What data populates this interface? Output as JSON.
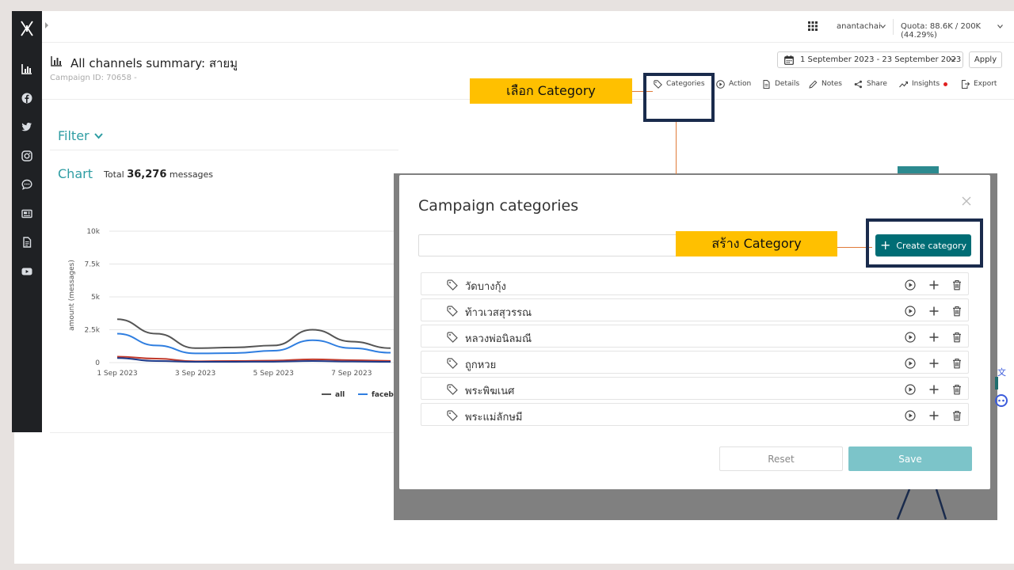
{
  "topbar": {
    "user_name": "anantachai",
    "quota": "Quota: 88.6K / 200K (44.29%)"
  },
  "header": {
    "title": "All channels summary: สายมู",
    "campaign_id": "Campaign ID: 70658 -",
    "date_range": "1 September 2023 - 23 September 2023",
    "apply_label": "Apply"
  },
  "toolbar": {
    "items": [
      {
        "label": "Categories",
        "icon": "tag-icon"
      },
      {
        "label": "Action",
        "icon": "play-icon"
      },
      {
        "label": "Details",
        "icon": "document-icon"
      },
      {
        "label": "Notes",
        "icon": "pencil-icon"
      },
      {
        "label": "Share",
        "icon": "share-icon"
      },
      {
        "label": "Insights",
        "icon": "trend-icon"
      },
      {
        "label": "Export",
        "icon": "export-icon"
      }
    ]
  },
  "annotations": {
    "select_category": "เลือก Category",
    "create_category": "สร้าง Category"
  },
  "filter": {
    "title": "Filter"
  },
  "chart": {
    "title": "Chart",
    "total_prefix": "Total",
    "total_value": "36,276",
    "total_suffix": "messages"
  },
  "chart_data": {
    "type": "line",
    "title": "",
    "xlabel": "",
    "ylabel": "amount (messages)",
    "x": [
      "1 Sep 2023",
      "2 Sep 2023",
      "3 Sep 2023",
      "4 Sep 2023",
      "5 Sep 2023",
      "6 Sep 2023",
      "7 Sep 2023",
      "8 Sep 2023"
    ],
    "x_ticks": [
      "1 Sep 2023",
      "3 Sep 2023",
      "5 Sep 2023",
      "7 Sep 2023"
    ],
    "y_ticks": [
      "0",
      "2.5k",
      "5k",
      "7.5k",
      "10k"
    ],
    "ylim": [
      0,
      10000
    ],
    "legend_position": "bottom",
    "series": [
      {
        "name": "all",
        "color": "#555555",
        "values": [
          3300,
          2200,
          1100,
          1150,
          1300,
          2500,
          1600,
          1100
        ]
      },
      {
        "name": "facebo",
        "color": "#2f7ee0",
        "values": [
          2200,
          1300,
          700,
          720,
          900,
          1700,
          1100,
          750
        ]
      },
      {
        "name": "",
        "color": "#c0392b",
        "values": [
          450,
          300,
          100,
          120,
          150,
          250,
          180,
          130
        ]
      },
      {
        "name": "",
        "color": "#1e3a8a",
        "values": [
          350,
          120,
          60,
          60,
          70,
          120,
          80,
          60
        ]
      }
    ]
  },
  "modal": {
    "title": "Campaign categories",
    "search_placeholder": "",
    "create_label": "Create category",
    "categories": [
      {
        "name": "วัดบางกุ้ง"
      },
      {
        "name": "ท้าวเวสสุวรรณ"
      },
      {
        "name": "หลวงพ่อนิลมณี"
      },
      {
        "name": "ถูกหวย"
      },
      {
        "name": "พระพิฆเนศ"
      },
      {
        "name": "พระแม่ลักษมี"
      }
    ],
    "reset_label": "Reset",
    "save_label": "Save"
  },
  "colors": {
    "accent": "#2e9da3",
    "primary_button": "#006d75",
    "save_button": "#7cc4c9",
    "callout": "#ffc000",
    "highlight_border": "#1a2b4c",
    "connector": "#e07b39"
  }
}
